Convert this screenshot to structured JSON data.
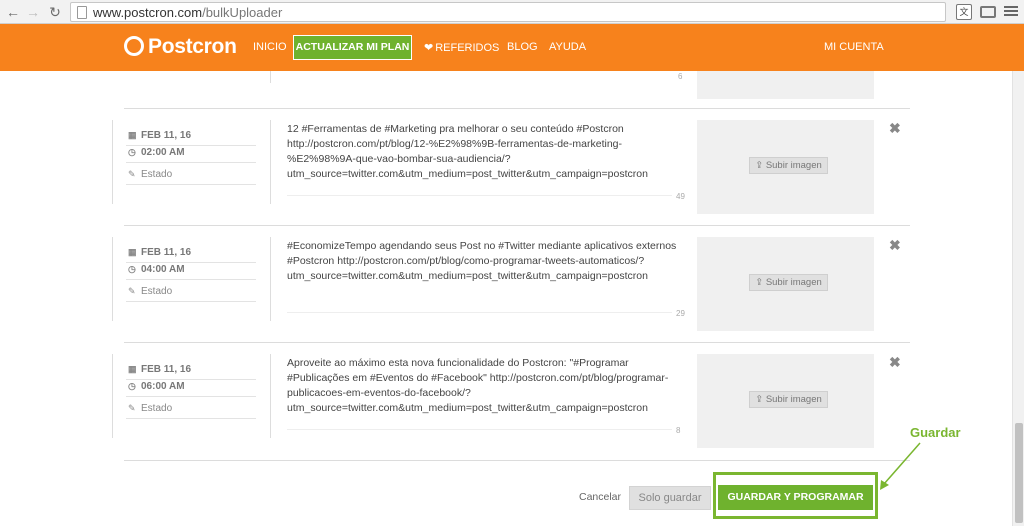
{
  "browser": {
    "url_domain": "www.postcron.com",
    "url_path": "/bulkUploader",
    "translate_glyph": "文"
  },
  "header": {
    "logo": "Postcron",
    "nav": {
      "inicio": "INICIO",
      "plan": "ACTUALIZAR MI PLAN",
      "referidos": "REFERIDOS",
      "blog": "BLOG",
      "ayuda": "AYUDA",
      "cuenta": "MI CUENTA"
    }
  },
  "top_stub": {
    "count": "6"
  },
  "posts": [
    {
      "date": "FEB 11, 16",
      "time": "02:00 AM",
      "status": "Estado",
      "lines": [
        "12 #Ferramentas de #Marketing pra melhorar o seu conteúdo #Postcron",
        "http://postcron.com/pt/blog/12-%E2%98%9B-ferramentas-de-marketing-",
        "%E2%98%9A-que-vao-bombar-sua-audiencia/?",
        "utm_source=twitter.com&utm_medium=post_twitter&utm_campaign=postcron"
      ],
      "count": "49",
      "upload_label": "Subir imagen"
    },
    {
      "date": "FEB 11, 16",
      "time": "04:00 AM",
      "status": "Estado",
      "lines": [
        "#EconomizeTempo agendando seus Post no #Twitter mediante aplicativos externos",
        "#Postcron http://postcron.com/pt/blog/como-programar-tweets-automaticos/?",
        "utm_source=twitter.com&utm_medium=post_twitter&utm_campaign=postcron"
      ],
      "count": "29",
      "upload_label": "Subir imagen"
    },
    {
      "date": "FEB 11, 16",
      "time": "06:00 AM",
      "status": "Estado",
      "lines": [
        "Aproveite ao máximo esta nova funcionalidade do Postcron: \"#Programar",
        "#Publicações em #Eventos do #Facebook\" http://postcron.com/pt/blog/programar-",
        "publicacoes-em-eventos-do-facebook/?",
        "utm_source=twitter.com&utm_medium=post_twitter&utm_campaign=postcron"
      ],
      "count": "8",
      "upload_label": "Subir imagen"
    }
  ],
  "footer": {
    "cancel": "Cancelar",
    "solo_guardar": "Solo guardar",
    "guardar_programar": "GUARDAR Y PROGRAMAR"
  },
  "annotation": {
    "label": "Guardar",
    "color": "#7ab630"
  },
  "colors": {
    "brand_orange": "#f7821c",
    "accent_green": "#6fb22e"
  }
}
